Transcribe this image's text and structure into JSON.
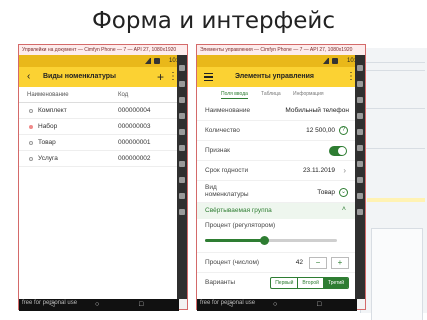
{
  "slide": {
    "title": "Форма и интерфейс"
  },
  "watermark": "free for personal use",
  "left_phone": {
    "window_title": "Упрвлейки на документ — Cimfyn Phone — 7 — API 27, 1080x1920",
    "status_time": "10:43",
    "appbar_title": "Виды номенклатуры",
    "columns": [
      "Наименование",
      "Код"
    ],
    "rows": [
      {
        "name": "Комплект",
        "code": "000000004",
        "selected": false
      },
      {
        "name": "Набор",
        "code": "000000003",
        "selected": true
      },
      {
        "name": "Товар",
        "code": "000000001",
        "selected": false
      },
      {
        "name": "Услуга",
        "code": "000000002",
        "selected": false
      }
    ]
  },
  "right_phone": {
    "window_title": "Элементы управления — Cimfyn Phone — 7 — API 27, 1080x1920",
    "status_time": "10:40",
    "appbar_title": "Элементы управления",
    "tabs": [
      "Поля ввода",
      "Таблица",
      "Информация"
    ],
    "active_tab": "Поля ввода",
    "fields": {
      "name_label": "Наименование",
      "name_value": "Мобильный телефон",
      "qty_label": "Количество",
      "qty_value": "12 500,00",
      "flag_label": "Признак",
      "flag_on": true,
      "expiry_label": "Срок годности",
      "expiry_value": "23.11.2019",
      "kind_label": "Вид номенклатуры",
      "kind_value": "Товар"
    },
    "group": {
      "title": "Свёртываемая группа",
      "slider_label": "Процент (регулятором)",
      "slider_fraction": 0.45,
      "number_label": "Процент (числом)",
      "number_value": "42",
      "minus": "−",
      "plus": "+",
      "variants_label": "Варианты",
      "variants": [
        "Первый",
        "Второй",
        "Третий"
      ],
      "selected_variant": "Третий"
    }
  },
  "nav": {
    "back": "◁",
    "home": "○",
    "recent": "□"
  },
  "colors": {
    "accent_yellow": "#fbd233",
    "accent_green": "#2e7d32",
    "frame_red": "#d46a6a"
  }
}
